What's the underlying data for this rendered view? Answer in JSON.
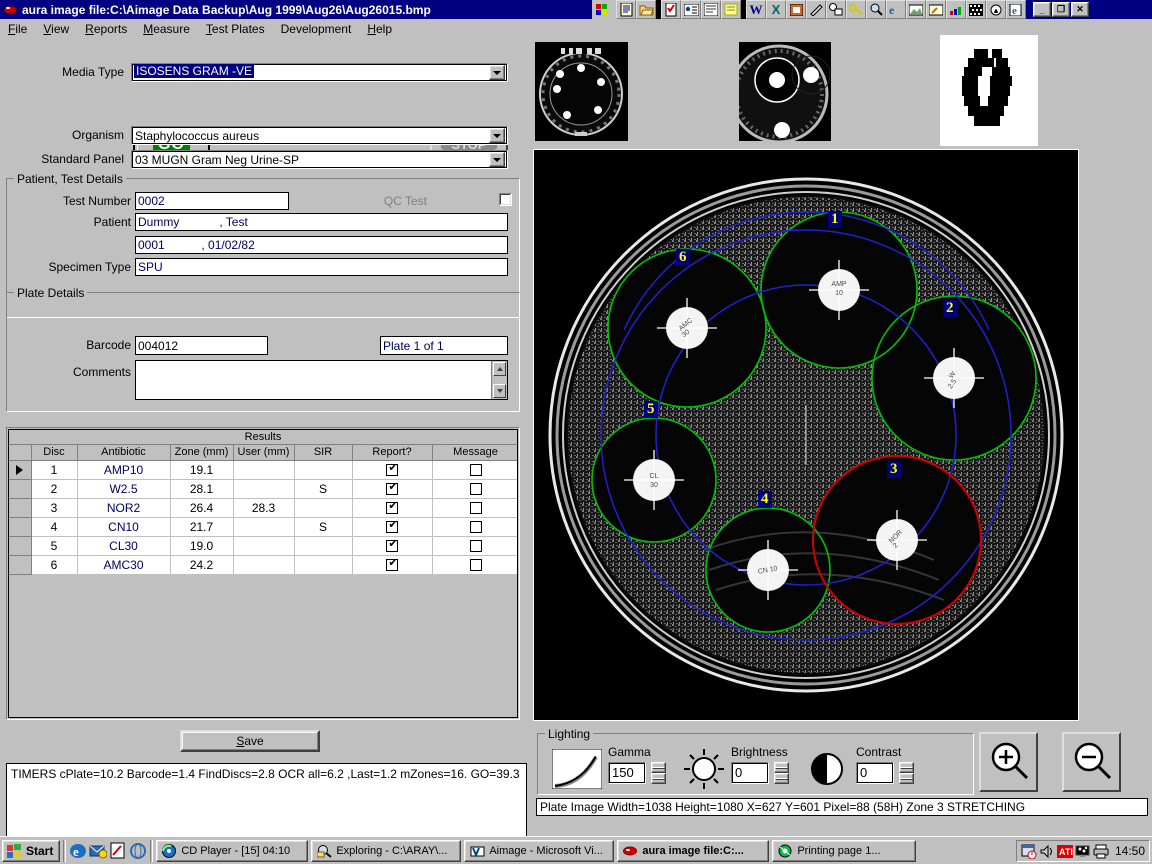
{
  "window": {
    "title": "aura image file:C:\\Aimage Data Backup\\Aug 1999\\Aug26\\Aug26015.bmp",
    "icon": "aura-app-icon",
    "minimize": "_",
    "maximize": "❐",
    "close": "✕"
  },
  "menu": {
    "items": [
      {
        "label": "File",
        "accel": "F"
      },
      {
        "label": "View",
        "accel": "V"
      },
      {
        "label": "Reports",
        "accel": "R"
      },
      {
        "label": "Measure",
        "accel": "M"
      },
      {
        "label": "Test Plates",
        "accel": "T"
      },
      {
        "label": "Development",
        "accel": ""
      },
      {
        "label": "Help",
        "accel": "H"
      }
    ]
  },
  "form": {
    "media_type_label": "Media Type",
    "media_type_value": "ISOSENS GRAM -VE",
    "go_label": "GO",
    "stop_label": "STOP",
    "organism_label": "Organism",
    "organism_value": "Staphylococcus aureus",
    "standard_panel_label": "Standard Panel",
    "standard_panel_value": "03 MUGN Gram Neg Urine-SP"
  },
  "patient_group": {
    "title": "Patient, Test Details",
    "test_number_label": "Test Number",
    "test_number_value": "0002",
    "qc_test_label": "QC Test",
    "qc_test_checked": false,
    "patient_label": "Patient",
    "patient_value": "Dummy            , Test",
    "patient_id_value": "0001           , 01/02/82",
    "specimen_type_label": "Specimen Type",
    "specimen_type_value": "SPU"
  },
  "plate_group": {
    "title": "Plate Details",
    "barcode_label": "Barcode",
    "barcode_value": "004012",
    "plate_of_value": "Plate 1 of 1",
    "comments_label": "Comments",
    "comments_value": ""
  },
  "results": {
    "caption": "Results",
    "columns": [
      "",
      "Disc",
      "Antibiotic",
      "Zone (mm)",
      "User (mm)",
      "SIR",
      "Report?",
      "Message"
    ],
    "rows": [
      {
        "marker": true,
        "disc": "1",
        "antibiotic": "AMP10",
        "zone": "19.1",
        "user": "",
        "sir": "",
        "report": true,
        "message": false
      },
      {
        "marker": false,
        "disc": "2",
        "antibiotic": "W2.5",
        "zone": "28.1",
        "user": "",
        "sir": "S",
        "report": true,
        "message": false
      },
      {
        "marker": false,
        "disc": "3",
        "antibiotic": "NOR2",
        "zone": "26.4",
        "user": "28.3",
        "sir": "",
        "report": true,
        "message": false
      },
      {
        "marker": false,
        "disc": "4",
        "antibiotic": "CN10",
        "zone": "21.7",
        "user": "",
        "sir": "S",
        "report": true,
        "message": false
      },
      {
        "marker": false,
        "disc": "5",
        "antibiotic": "CL30",
        "zone": "19.0",
        "user": "",
        "sir": "",
        "report": true,
        "message": false
      },
      {
        "marker": false,
        "disc": "6",
        "antibiotic": "AMC30",
        "zone": "24.2",
        "user": "",
        "sir": "",
        "report": true,
        "message": false
      }
    ]
  },
  "save_button": {
    "label": "Save",
    "accel": "S"
  },
  "timers": {
    "text": "TIMERS  cPlate=10.2 Barcode=1.4 FindDiscs=2.8 OCR all=6.2 ,Last=1.2 mZones=16. GO=39.3"
  },
  "lighting": {
    "title": "Lighting",
    "gamma_label": "Gamma",
    "gamma_value": "150",
    "brightness_label": "Brightness",
    "brightness_value": "0",
    "contrast_label": "Contrast",
    "contrast_value": "0",
    "zoom_in": "zoom-in-icon",
    "zoom_out": "zoom-out-icon"
  },
  "status": {
    "text": "Plate Image Width=1038 Height=1080 X=627 Y=601 Pixel=88 (58H) Zone 3 STRETCHING"
  },
  "plate_image": {
    "discs": [
      {
        "id": "1",
        "code": "AMP\n10"
      },
      {
        "id": "2",
        "code": "W\n2.5"
      },
      {
        "id": "3",
        "code": "NOR\n2"
      },
      {
        "id": "4",
        "code": "CN\n10"
      },
      {
        "id": "5",
        "code": "CL\n30"
      },
      {
        "id": "6",
        "code": "AMC\n30"
      }
    ],
    "zone_colors": {
      "measured": "#00c000",
      "expected": "#2020d0",
      "selected": "#d00000"
    }
  },
  "taskbar": {
    "start_label": "Start",
    "quick_launch": [
      "internet-explorer-icon",
      "outlook-express-icon",
      "notepad-icon",
      "channel-viewer-icon"
    ],
    "tasks": [
      {
        "label": "CD Player - [15] 04:10",
        "icon": "cd-player-icon",
        "active": false
      },
      {
        "label": "Exploring - C:\\ARAY\\...",
        "icon": "explorer-icon",
        "active": false
      },
      {
        "label": "Aimage - Microsoft Vi...",
        "icon": "visual-basic-icon",
        "active": false
      },
      {
        "label": "aura image file:C:...",
        "icon": "aura-app-icon",
        "active": true
      },
      {
        "label": "Printing page  1...",
        "icon": "printing-icon",
        "active": false
      }
    ],
    "tray_icons": [
      "scheduler-icon",
      "volume-icon",
      "ati-icon",
      "display-icon",
      "printer-icon"
    ],
    "clock": "14:50"
  },
  "toolstrip": {
    "buttons": [
      "office-logo-icon",
      "notepad-icon",
      "open-folder-icon",
      "task-list-icon",
      "contacts-icon",
      "journal-icon",
      "notes-icon",
      "word-icon",
      "excel-icon",
      "powerpoint-icon",
      "binder-icon",
      "schedule-icon",
      "key-icon",
      "find-icon",
      "internet-explorer-icon",
      "photo-editor-icon",
      "paint-icon",
      "palette-icon",
      "grid-icon",
      "aura-icon",
      "ie-doc-icon"
    ]
  }
}
